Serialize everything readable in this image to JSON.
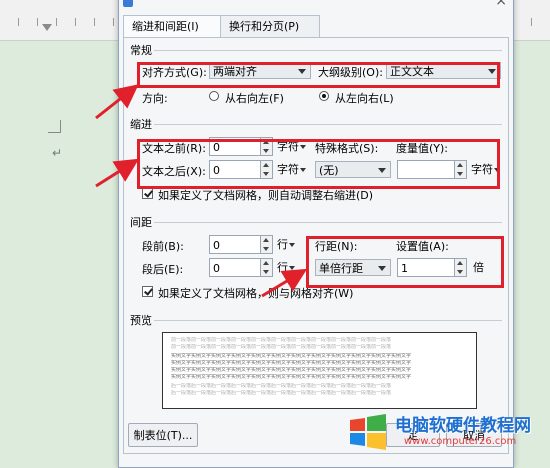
{
  "dialog": {
    "title_glyph": "",
    "close_glyph": "×",
    "tabs": [
      "缩进和间距(I)",
      "换行和分页(P)"
    ]
  },
  "general": {
    "section": "常规",
    "align_label": "对齐方式(G):",
    "align_value": "两端对齐",
    "outline_label": "大纲级别(O):",
    "outline_value": "正文文本",
    "direction_label": "方向:",
    "rtl_label": "从右向左(F)",
    "ltr_label": "从左向右(L)",
    "ltr_selected": true
  },
  "indent": {
    "section": "缩进",
    "before_label": "文本之前(R):",
    "before_value": "0",
    "before_unit": "字符",
    "special_label": "特殊格式(S):",
    "measure_label": "度量值(Y):",
    "after_label": "文本之后(X):",
    "after_value": "0",
    "after_unit": "字符",
    "special_value": "(无)",
    "measure_value": "",
    "measure_unit": "字符",
    "auto_adjust_label": "如果定义了文档网格，则自动调整右缩进(D)",
    "auto_adjust_checked": true
  },
  "spacing": {
    "section": "间距",
    "before_label": "段前(B):",
    "before_value": "0",
    "before_unit": "行",
    "after_label": "段后(E):",
    "after_value": "0",
    "after_unit": "行",
    "line_label": "行距(N):",
    "line_value": "单倍行距",
    "setvalue_label": "设置值(A):",
    "setvalue_value": "1",
    "setvalue_unit": "倍",
    "grid_label": "如果定义了文档网格，则与网格对齐(W)",
    "grid_checked": true
  },
  "preview": {
    "section": "预览",
    "prev_line": "前一段落前一段落前一段落前一段落前一段落前一段落前一段落前一段落前一段落前一段落前一段落",
    "sample_line": "实例文字实例文字实例文字实例文字实例文字实例文字实例文字实例文字实例文字实例文字实例文字实例文字",
    "next_line": "后一段落后一段落后一段落后一段落后一段落后一段落后一段落后一段落后一段落后一段落后一段落"
  },
  "buttons": {
    "tabs": "制表位(T)...",
    "ok": "定",
    "cancel": "取消"
  },
  "watermark": {
    "title": "电脑软硬件教程网",
    "url": "www.computer26.com"
  },
  "annotation_color": "#e0202a"
}
